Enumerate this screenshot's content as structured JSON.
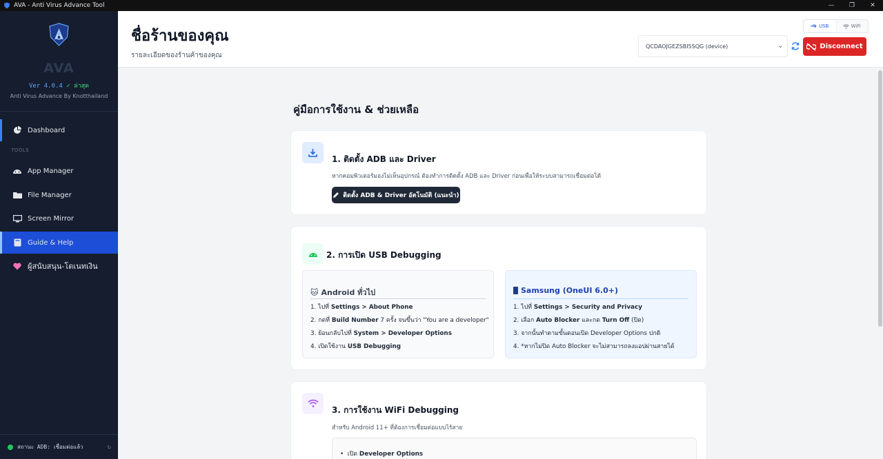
{
  "window": {
    "title": "AVA - Anti Virus Advance Tool"
  },
  "sidebar": {
    "brand_name": "AVA",
    "version": "Ver 4.0.4",
    "version_status": "✓ ล่าสุด",
    "byline": "Anti Virus Advance By Knotthailand",
    "tools_label": "TOOLS",
    "items": [
      {
        "label": "Dashboard",
        "icon": "pie-chart-icon"
      },
      {
        "label": "App Manager",
        "icon": "android-icon"
      },
      {
        "label": "File Manager",
        "icon": "folder-icon"
      },
      {
        "label": "Screen Mirror",
        "icon": "monitor-icon"
      },
      {
        "label": "Guide & Help",
        "icon": "book-icon",
        "active": true
      },
      {
        "label": "ผู้สนับสนุน-โดเนทเงิน",
        "icon": "heart-icon"
      }
    ],
    "adb_status": "สถานะ ADB: เชื่อมต่อแล้ว"
  },
  "header": {
    "title": "ชื่อร้านของคุณ",
    "subtitle": "รายละเอียดของร้านค้าของคุณ",
    "connection_modes": [
      "USB",
      "WiFi"
    ],
    "connection_selected": "USB",
    "device_selected": "QCDAOJGEZSBI5SQG (device)",
    "disconnect_label": "Disconnect"
  },
  "guide": {
    "title": "คู่มือการใช้งาน & ช่วยเหลือ",
    "sections": [
      {
        "title": "1. ติดตั้ง ADB และ Driver",
        "desc": "หากคอมพิวเตอร์มองไม่เห็นอุปกรณ์ ต้องทำการติดตั้ง ADB และ Driver ก่อนเพื่อให้ระบบสามารถเชื่อมต่อได้",
        "button": "ติดตั้ง ADB & Driver อัตโนมัติ (แนะนำ)"
      },
      {
        "title": "2. การเปิด USB Debugging",
        "android": {
          "title": "Android ทั่วไป",
          "steps": [
            {
              "pre": "ไปที่ ",
              "bold": "Settings > About Phone",
              "post": ""
            },
            {
              "pre": "กดที่ ",
              "bold": "Build Number",
              "post": " 7 ครั้ง จนขึ้นว่า \"You are a developer\""
            },
            {
              "pre": "ย้อนกลับไปที่ ",
              "bold": "System > Developer Options",
              "post": ""
            },
            {
              "pre": "เปิดใช้งาน ",
              "bold": "USB Debugging",
              "post": ""
            }
          ]
        },
        "samsung": {
          "title": "Samsung (OneUI 6.0+)",
          "steps": [
            {
              "pre": "ไปที่ ",
              "bold": "Settings > Security and Privacy",
              "post": ""
            },
            {
              "pre": "เลือก ",
              "bold": "Auto Blocker",
              "post": " และกด ",
              "bold2": "Turn Off",
              "post2": " (ปิด)"
            },
            {
              "pre": "จากนั้นทำตามขั้นตอนเปิด Developer Options ปกติ",
              "bold": "",
              "post": ""
            },
            {
              "pre": "*หากไม่ปิด Auto Blocker จะไม่สามารถลงแอปผ่านสายได้",
              "bold": "",
              "post": ""
            }
          ]
        }
      },
      {
        "title": "3. การใช้งาน WiFi Debugging",
        "desc": "สำหรับ Android 11+ ที่ต้องการเชื่อมต่อแบบไร้สาย",
        "first_item_pre": "เปิด ",
        "first_item_bold": "Developer Options"
      }
    ]
  },
  "colors": {
    "sidebar_bg": "#151d2e",
    "accent": "#1d4ed8",
    "danger": "#dc2626"
  }
}
